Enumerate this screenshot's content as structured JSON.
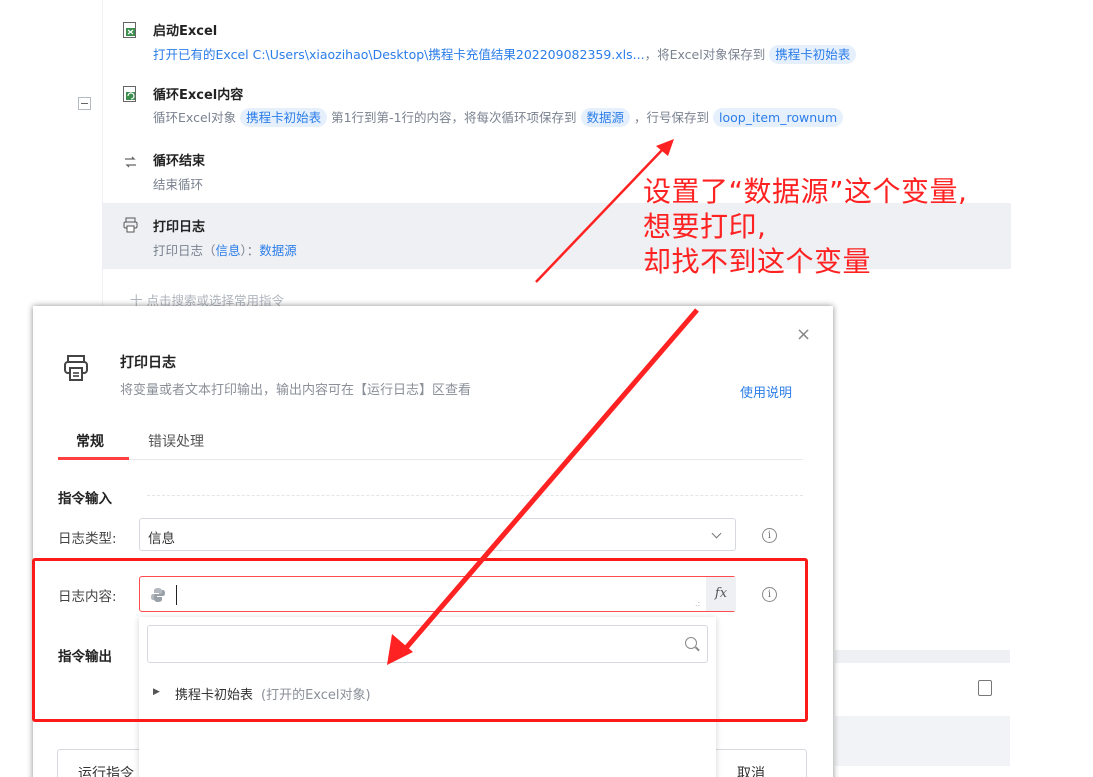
{
  "flow": {
    "steps": [
      {
        "title": "启动Excel",
        "desc_prefix": "打开已有的Excel C:\\Users\\xiaozihao\\Desktop\\携程卡充值结果202209082359.xls...",
        "desc_mid": "，将Excel对象保存到",
        "chip": "携程卡初始表",
        "icon": "excel-icon"
      },
      {
        "title": "循环Excel内容",
        "desc_a": "循环Excel对象",
        "chip_a": "携程卡初始表",
        "desc_b": "第1行到第-1行的内容，将每次循环项保存到",
        "chip_b": "数据源",
        "desc_c": "，行号保存到",
        "chip_c": "loop_item_rownum",
        "icon": "excel-loop-icon"
      },
      {
        "title": "循环结束",
        "desc": "结束循环",
        "icon": "loop-end-icon"
      },
      {
        "title": "打印日志",
        "desc_a": "打印日志（",
        "desc_level": "信息",
        "desc_b": "）：",
        "desc_var": "数据源",
        "icon": "printer-icon"
      }
    ],
    "add_command": "十  点击搜索或选择常用指令"
  },
  "annotation": {
    "line1": "设置了“数据源”这个变量,",
    "line2": "想要打印,",
    "line3": "却找不到这个变量",
    "color": "#ff2222"
  },
  "modal": {
    "close": "×",
    "title": "打印日志",
    "subtitle": "将变量或者文本打印输出，输出内容可在【运行日志】区查看",
    "help_link": "使用说明",
    "tabs": [
      "常规",
      "错误处理"
    ],
    "section_input": "指令输入",
    "log_type_label": "日志类型:",
    "log_type_value": "信息",
    "log_content_label": "日志内容:",
    "fx": "fx",
    "section_output": "指令输出",
    "dropdown": {
      "search_placeholder": "",
      "items": [
        {
          "name": "携程卡初始表",
          "type": "(打开的Excel对象)"
        }
      ]
    },
    "run_button": "运行指令",
    "cancel_button": "取消"
  },
  "colors": {
    "accent_blue": "#2b7de9",
    "highlight_red": "#ff1a1a"
  }
}
